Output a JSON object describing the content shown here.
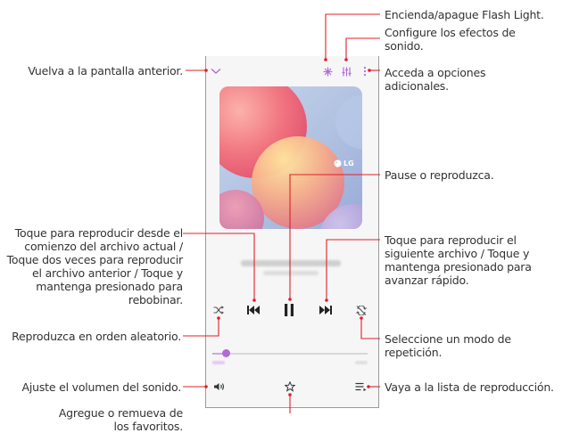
{
  "annotations": {
    "back": "Vuelva a la pantalla anterior.",
    "flash": "Encienda/apague Flash Light.",
    "sound_effects": "Configure los efectos de sonido.",
    "more_options": "Acceda a opciones adicionales.",
    "pause_play": "Pause o reproduzca.",
    "previous": "Toque para reproducir desde el comienzo del archivo actual / Toque dos veces para reproducir el archivo anterior / Toque y mantenga presionado para rebobinar.",
    "next": "Toque para reproducir el siguiente archivo / Toque y mantenga presionado para avanzar rápido.",
    "shuffle": "Reproduzca en orden aleatorio.",
    "repeat": "Seleccione un modo de repetición.",
    "volume": "Ajuste el volumen del sonido.",
    "playlist": "Vaya a la lista de reproducción.",
    "favorites": "Agregue o remueva de los favoritos."
  },
  "album": {
    "logo_text": "LG"
  },
  "player": {
    "progress_fraction": 0.09
  },
  "colors": {
    "accent": "#b06cd6",
    "leader_line": "#e0202a"
  },
  "icons": {
    "back": "chevron-down-icon",
    "flash": "flashlight-icon",
    "sound_effects": "equalizer-icon",
    "more_options": "more-vertical-icon",
    "previous": "skip-previous-icon",
    "pause": "pause-icon",
    "next": "skip-next-icon",
    "shuffle": "shuffle-icon",
    "repeat": "repeat-icon",
    "volume": "volume-icon",
    "favorite": "star-icon",
    "playlist": "playlist-icon"
  }
}
